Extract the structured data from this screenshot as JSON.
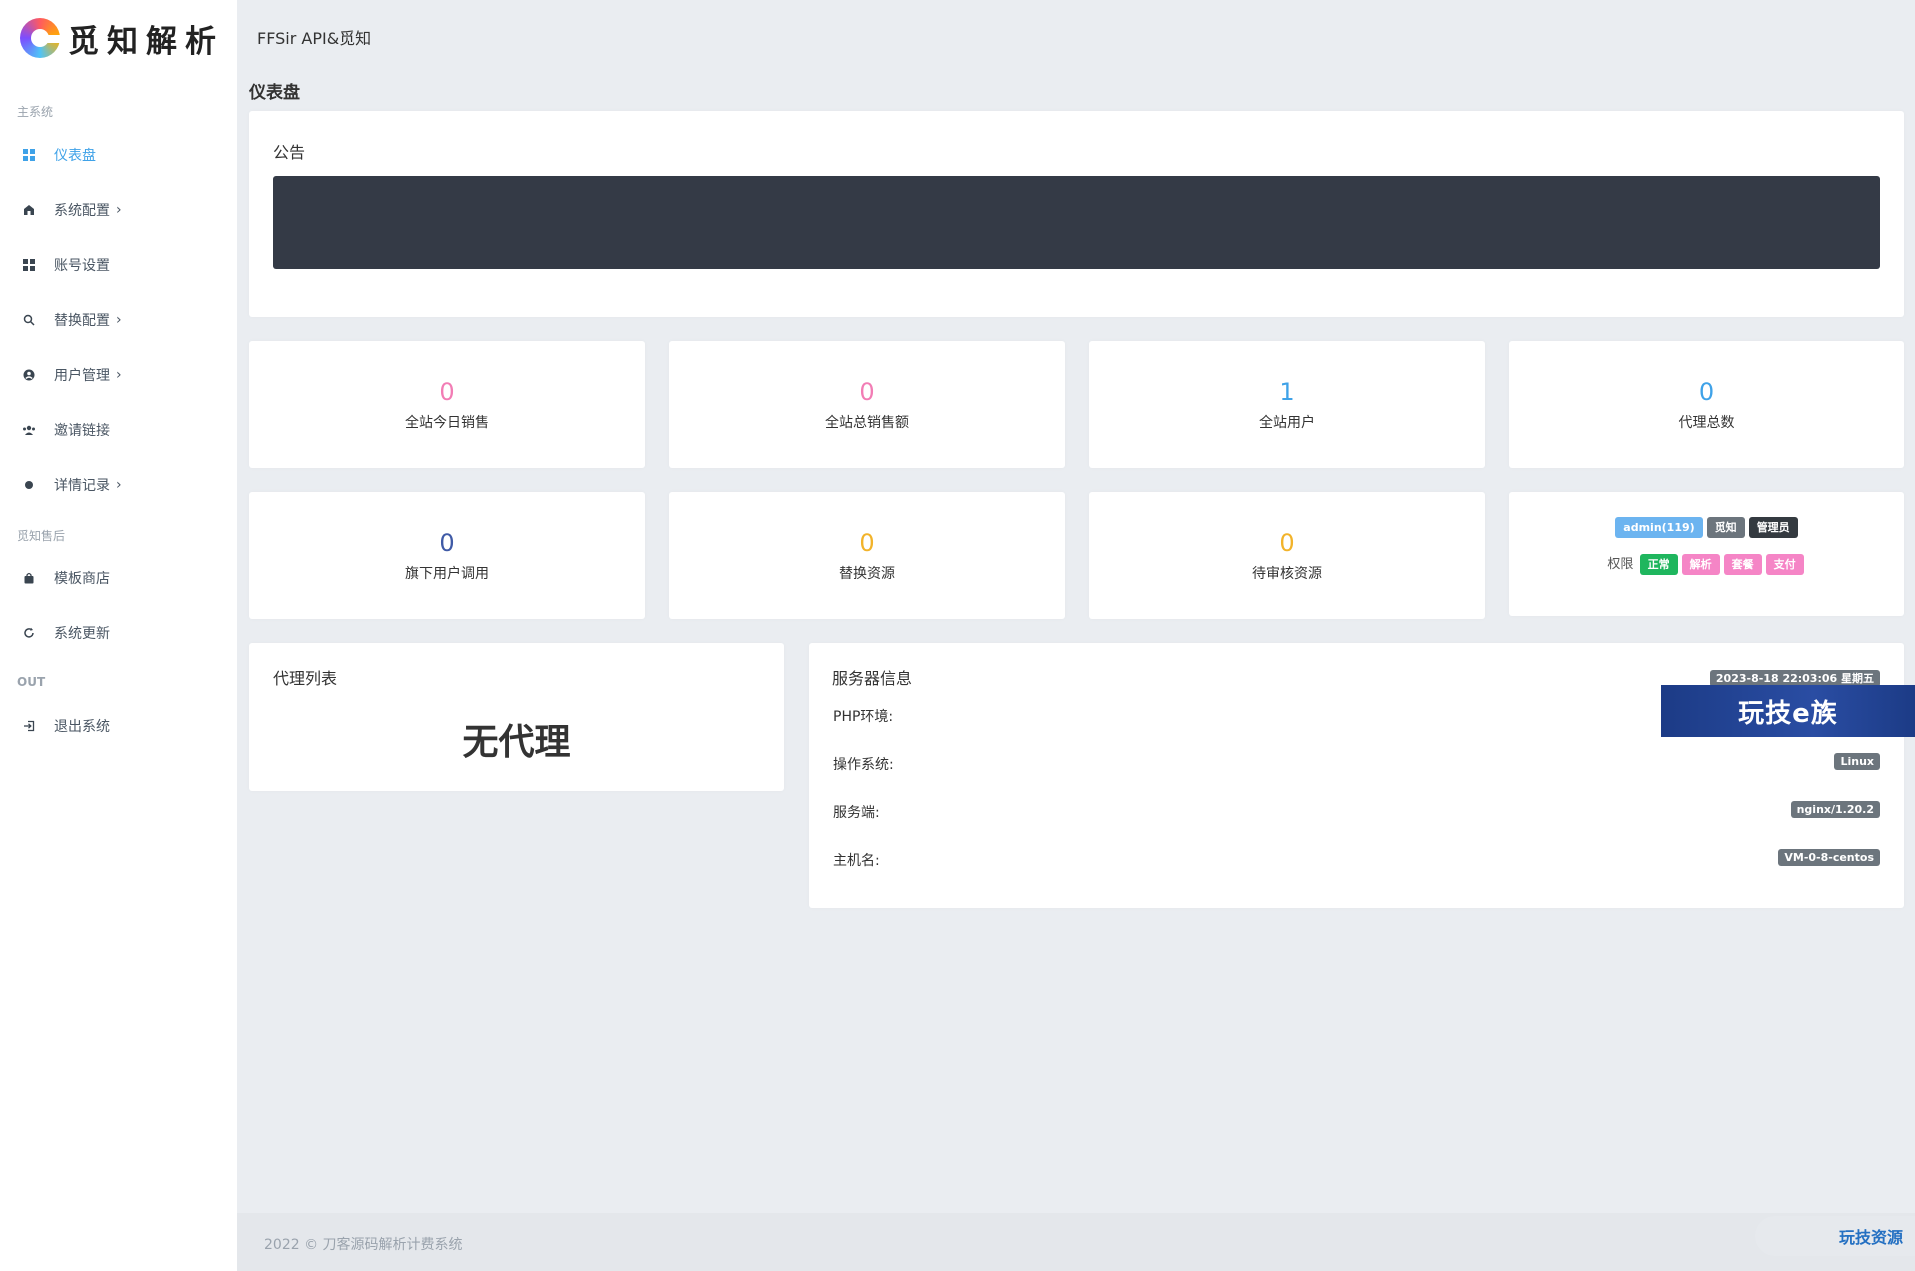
{
  "app": {
    "logo_text": "觅知解析",
    "header_title": "FFSir API&觅知",
    "page_title": "仪表盘"
  },
  "sidebar": {
    "section_main": "主系统",
    "section_after": "觅知售后",
    "section_out": "OUT",
    "items": [
      {
        "label": "仪表盘",
        "icon": "dashboard-grid-icon",
        "active": true
      },
      {
        "label": "系统配置",
        "icon": "home-icon",
        "has_submenu": true
      },
      {
        "label": "账号设置",
        "icon": "grid-icon"
      },
      {
        "label": "替换配置",
        "icon": "search-icon",
        "has_submenu": true
      },
      {
        "label": "用户管理",
        "icon": "user-circle-icon",
        "has_submenu": true
      },
      {
        "label": "邀请链接",
        "icon": "users-icon"
      },
      {
        "label": "详情记录",
        "icon": "dot-icon",
        "has_submenu": true
      },
      {
        "label": "模板商店",
        "icon": "shopping-bag-icon"
      },
      {
        "label": "系统更新",
        "icon": "refresh-icon"
      },
      {
        "label": "退出系统",
        "icon": "logout-icon"
      }
    ],
    "chevron": "›"
  },
  "notice": {
    "title": "公告"
  },
  "stats": [
    {
      "value": "0",
      "label": "全站今日销售",
      "color": "#f27db5"
    },
    {
      "value": "0",
      "label": "全站总销售额",
      "color": "#f27db5"
    },
    {
      "value": "1",
      "label": "全站用户",
      "color": "#3fa2e8"
    },
    {
      "value": "0",
      "label": "代理总数",
      "color": "#3fa2e8"
    },
    {
      "value": "0",
      "label": "旗下用户调用",
      "color": "#3f5aa6"
    },
    {
      "value": "0",
      "label": "替换资源",
      "color": "#f2b32a"
    },
    {
      "value": "0",
      "label": "待审核资源",
      "color": "#f2b32a"
    }
  ],
  "profile": {
    "badges_top": [
      {
        "text": "admin(119)",
        "color": "#6cb4f0"
      },
      {
        "text": "觅知",
        "color": "#6c757d"
      },
      {
        "text": "管理员",
        "color": "#343a40"
      }
    ],
    "perm_label": "权限",
    "badges_perm": [
      {
        "text": "正常",
        "color": "#1fb65e"
      },
      {
        "text": "解析",
        "color": "#f585c6"
      },
      {
        "text": "套餐",
        "color": "#f585c6"
      },
      {
        "text": "支付",
        "color": "#f585c6"
      }
    ]
  },
  "agents": {
    "title": "代理列表",
    "empty_text": "无代理"
  },
  "server": {
    "title": "服务器信息",
    "datetime": "2023-8-18 22:03:06 星期五",
    "php_label": "PHP环境:",
    "os_label": "操作系统:",
    "os_value": "Linux",
    "server_label": "服务端:",
    "server_value": "nginx/1.20.2",
    "host_label": "主机名:",
    "host_value": "VM-0-8-centos"
  },
  "footer": {
    "text": "2022 © 刀客源码解析计费系统"
  },
  "watermarks": {
    "banner": "玩技e族",
    "corner": "玩技资源"
  }
}
